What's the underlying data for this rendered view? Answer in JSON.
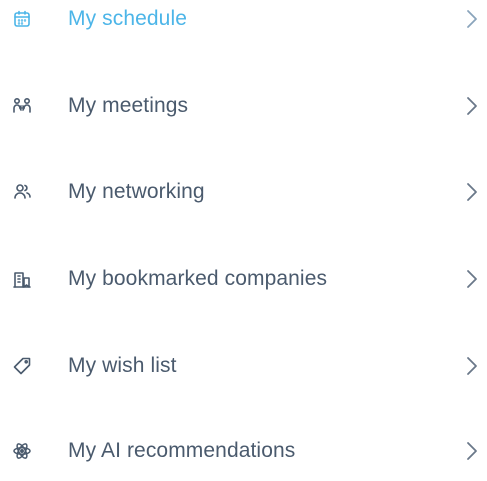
{
  "colors": {
    "active": "#4cb5e8",
    "text": "#4a5a6d",
    "chevron": "#6a7889"
  },
  "menu": {
    "items": [
      {
        "label": "My schedule",
        "icon": "calendar-icon",
        "active": true
      },
      {
        "label": "My meetings",
        "icon": "people-meeting-icon",
        "active": false
      },
      {
        "label": "My networking",
        "icon": "networking-icon",
        "active": false
      },
      {
        "label": "My bookmarked companies",
        "icon": "company-bookmark-icon",
        "active": false
      },
      {
        "label": "My wish list",
        "icon": "tag-icon",
        "active": false
      },
      {
        "label": "My AI recommendations",
        "icon": "atom-icon",
        "active": false
      }
    ]
  }
}
